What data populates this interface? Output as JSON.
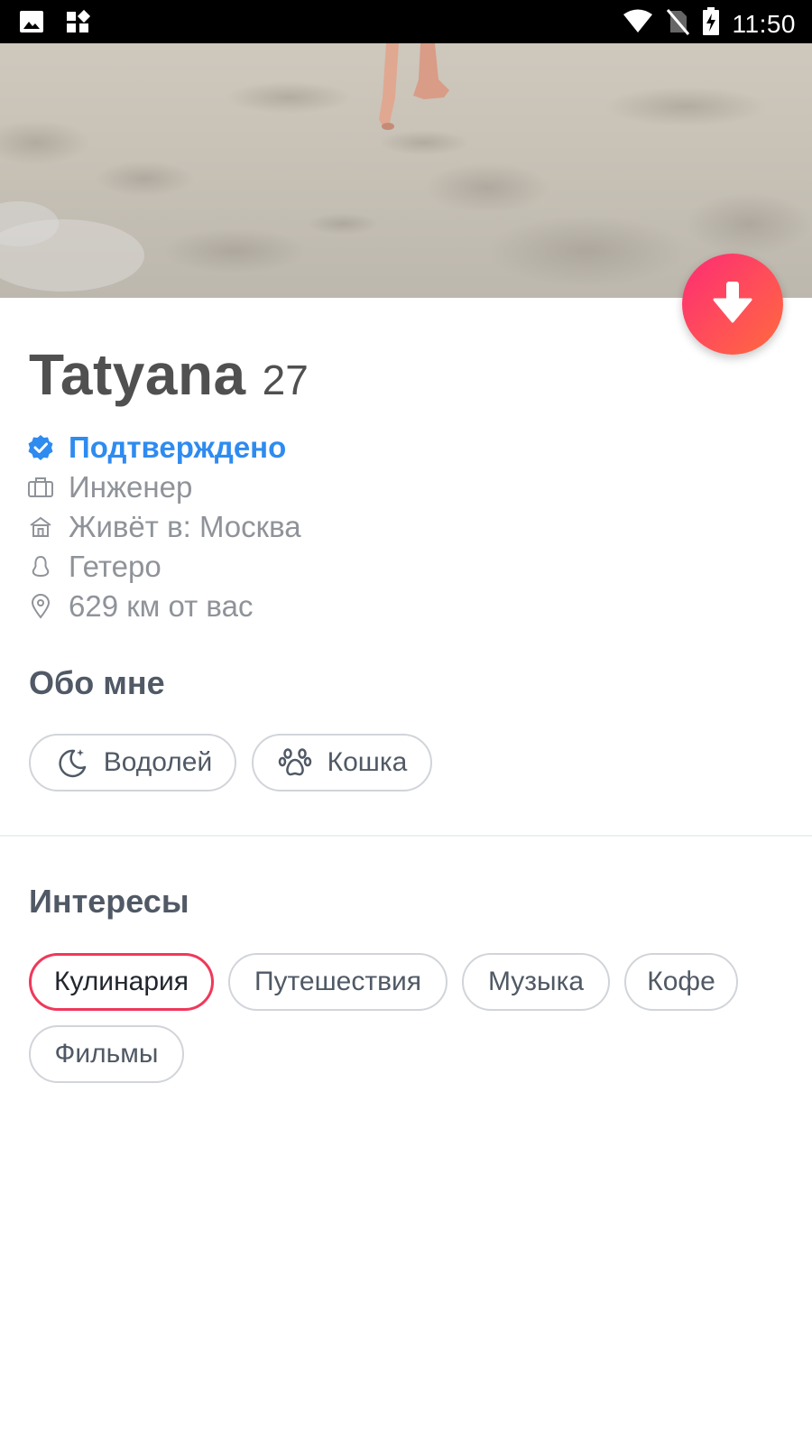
{
  "status_bar": {
    "time": "11:50",
    "icons": [
      "gallery-icon",
      "widgets-icon",
      "wifi-icon",
      "no-sim-icon",
      "battery-charging-icon"
    ]
  },
  "profile": {
    "name": "Tatyana",
    "age": "27",
    "verified_label": "Подтверждено",
    "job": "Инженер",
    "lives_in": "Живёт в: Москва",
    "orientation": "Гетеро",
    "distance": "629 км от вас"
  },
  "about": {
    "title": "Обо мне",
    "chips": [
      {
        "label": "Водолей",
        "icon": "moon-stars-icon"
      },
      {
        "label": "Кошка",
        "icon": "paw-icon"
      }
    ]
  },
  "interests": {
    "title": "Интересы",
    "chips": [
      {
        "label": "Кулинария",
        "selected": true
      },
      {
        "label": "Путешествия",
        "selected": false
      },
      {
        "label": "Музыка",
        "selected": false
      },
      {
        "label": "Кофе",
        "selected": false
      },
      {
        "label": "Фильмы",
        "selected": false
      }
    ]
  },
  "colors": {
    "accent": "#fd2c74",
    "verified": "#2e8bf0",
    "selected_border": "#f0385a"
  }
}
